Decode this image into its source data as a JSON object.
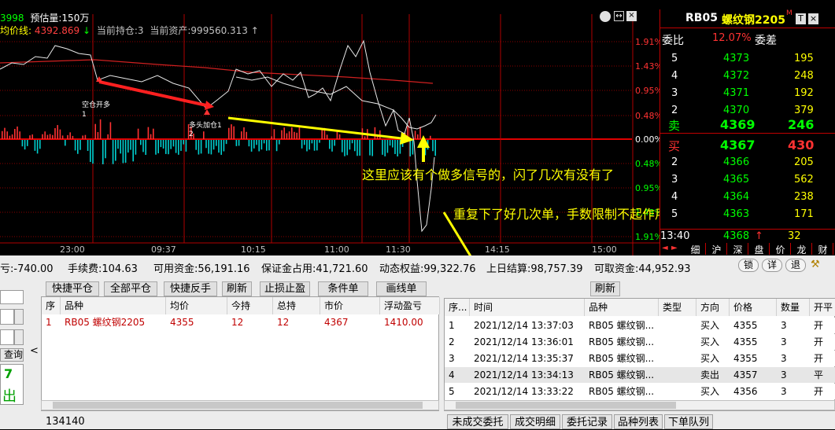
{
  "colors": {
    "up": "#ff3232",
    "down": "#00d0d0",
    "green": "#00ff00",
    "yellow": "#ffff00",
    "grid": "#8a0000"
  },
  "header": {
    "row1_prefix": "3998",
    "row1_label": "预估量:150万",
    "row2_label": "均价线:",
    "row2_value": "4392.869",
    "row2_arrow": "↓",
    "row2_pos": "当前持仓:3",
    "row2_assets": "当前资产:999560.313",
    "row2_arrow2": "↑"
  },
  "chart": {
    "pct_labels": [
      "1.91%",
      "1.43%",
      "0.95%",
      "0.48%",
      "0.00%",
      "0.48%",
      "0.95%",
      "1.43%",
      "1.91%"
    ],
    "time_labels": [
      "23:00",
      "09:37",
      "10:15",
      "11:00",
      "11:30",
      "14:15",
      "15:00"
    ],
    "signal1": "空仓开多",
    "signal1_num": "1",
    "signal2": "多头加仓1",
    "signal2_num": "2"
  },
  "annotations": {
    "text1": "这里应该有个做多信号的，闪了几次有没有了",
    "text2": "重复下了好几次单，手数限制不起作用"
  },
  "quote": {
    "code": "RB05",
    "name": "螺纹钢2205",
    "mark": "M",
    "btn_t": "T",
    "btn_x": "×",
    "ratio_label": "委比",
    "ratio_value": "12.07%",
    "diff_label": "委差",
    "sells": [
      {
        "level": "5",
        "price": "4373",
        "vol": "195"
      },
      {
        "level": "4",
        "price": "4372",
        "vol": "248"
      },
      {
        "level": "3",
        "price": "4371",
        "vol": "192"
      },
      {
        "level": "2",
        "price": "4370",
        "vol": "379"
      }
    ],
    "sell_label": "卖",
    "sell1_price": "4369",
    "sell1_vol": "246",
    "buy_label": "买",
    "buy1_price": "4367",
    "buy1_vol": "430",
    "buys": [
      {
        "level": "2",
        "price": "4366",
        "vol": "205"
      },
      {
        "level": "3",
        "price": "4365",
        "vol": "562"
      },
      {
        "level": "4",
        "price": "4364",
        "vol": "238"
      },
      {
        "level": "5",
        "price": "4363",
        "vol": "171"
      }
    ],
    "last_time": "13:40",
    "last_price": "4368",
    "last_arrow": "↑",
    "last_vol": "32",
    "bottom_tabs": [
      "细",
      "沪",
      "深",
      "盘",
      "价",
      "龙",
      "财"
    ]
  },
  "account": {
    "pnl": "亏:-740.00",
    "fee": "手续费:104.63",
    "avail": "可用资金:56,191.16",
    "margin": "保证金占用:41,721.60",
    "equity": "动态权益:99,322.76",
    "settle": "上日结算:98,757.39",
    "withdraw": "可取资金:44,952.93",
    "btn_lock": "锁",
    "btn_detail": "详",
    "btn_back": "退"
  },
  "toolbar": {
    "quick_close": "快捷平仓",
    "close_all": "全部平仓",
    "quick_reverse": "快捷反手",
    "refresh": "刷新",
    "stop": "止损止盈",
    "cond": "条件单",
    "line": "画线单",
    "refresh2": "刷新"
  },
  "left_panel": {
    "query": "查询",
    "num": "7",
    "out": "出"
  },
  "positions": {
    "headers": [
      "序",
      "品种",
      "均价",
      "今持",
      "总持",
      "市价",
      "浮动盈亏"
    ],
    "rows": [
      [
        "1",
        "RB05 螺纹钢2205",
        "4355",
        "12",
        "12",
        "4367",
        "1410.00"
      ]
    ],
    "status": "134140"
  },
  "orders": {
    "headers": [
      "序...",
      "时间",
      "品种",
      "类型",
      "方向",
      "价格",
      "数量",
      "开平"
    ],
    "rows": [
      [
        "1",
        "2021/12/14 13:37:03",
        "RB05 螺纹钢...",
        "",
        "买入",
        "4355",
        "3",
        "开"
      ],
      [
        "2",
        "2021/12/14 13:36:01",
        "RB05 螺纹钢...",
        "",
        "买入",
        "4355",
        "3",
        "开"
      ],
      [
        "3",
        "2021/12/14 13:35:37",
        "RB05 螺纹钢...",
        "",
        "买入",
        "4355",
        "3",
        "开"
      ],
      [
        "4",
        "2021/12/14 13:34:13",
        "RB05 螺纹钢...",
        "",
        "卖出",
        "4357",
        "3",
        "平"
      ],
      [
        "5",
        "2021/12/14 13:33:22",
        "RB05 螺纹钢...",
        "",
        "买入",
        "4356",
        "3",
        "开"
      ]
    ]
  },
  "tabs": [
    "未成交委托",
    "成交明细",
    "委托记录",
    "品种列表",
    "下单队列"
  ]
}
